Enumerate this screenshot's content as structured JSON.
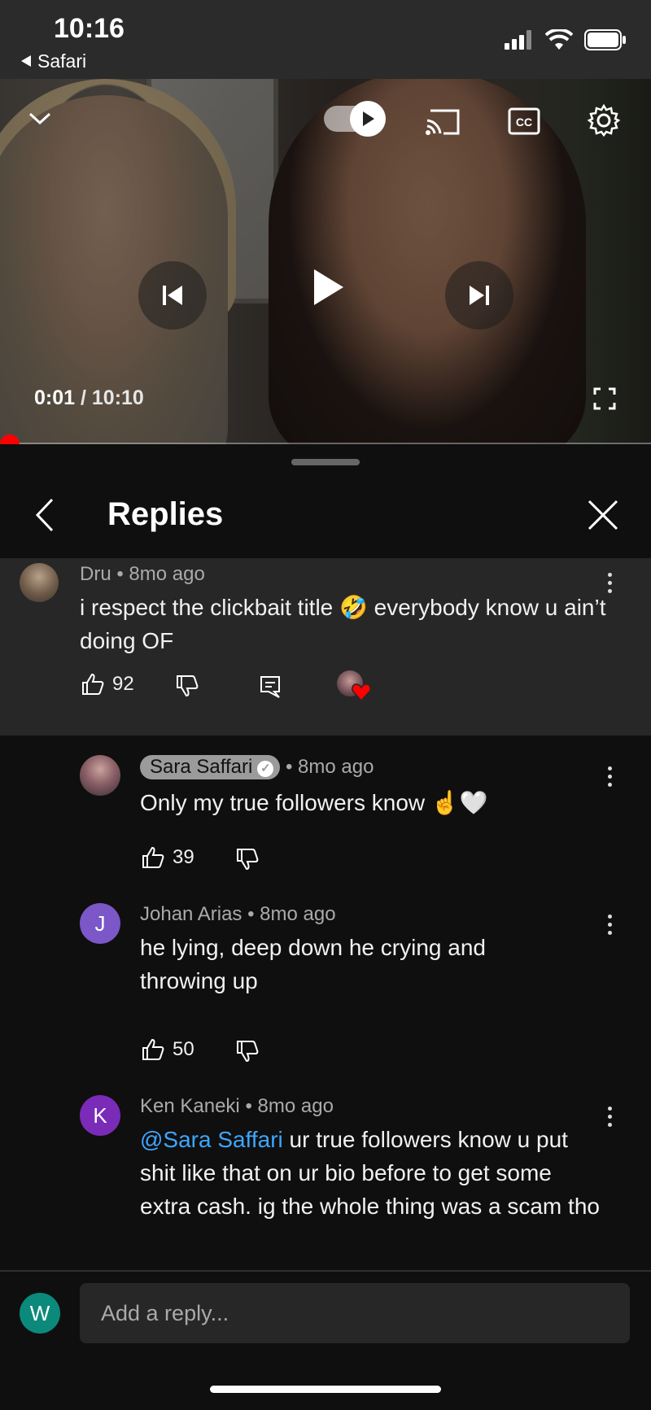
{
  "status_bar": {
    "time": "10:16",
    "back_label": "Safari"
  },
  "video": {
    "current_time": "0:01",
    "separator": " / ",
    "duration": "10:10",
    "progress_fraction": 0.002
  },
  "panel": {
    "title": "Replies"
  },
  "parent_comment": {
    "author": "Dru",
    "age": "8mo ago",
    "text": "i respect the clickbait title 🤣 everybody know u ain’t doing OF",
    "likes": "92"
  },
  "replies": [
    {
      "author": "Sara Saffari",
      "age": "8mo ago",
      "verified": true,
      "avatar_letter": "",
      "avatar_color": "#6a4a55",
      "text": "Only my true followers know ☝️🤍",
      "likes": "39"
    },
    {
      "author": "Johan Arias",
      "age": "8mo ago",
      "verified": false,
      "avatar_letter": "J",
      "avatar_color": "#7b57c8",
      "text": "he lying, deep down he crying and throwing up",
      "likes": "50"
    },
    {
      "author": "Ken Kaneki",
      "age": "8mo ago",
      "verified": false,
      "avatar_letter": "K",
      "avatar_color": "#7a2bb8",
      "mention": "@Sara Saffari",
      "text": " ur true followers know u put shit like that on ur bio before to get some extra cash. ig the whole thing was a scam tho"
    }
  ],
  "reply_box": {
    "avatar_letter": "W",
    "placeholder": "Add a reply..."
  },
  "separator_dot": "•"
}
